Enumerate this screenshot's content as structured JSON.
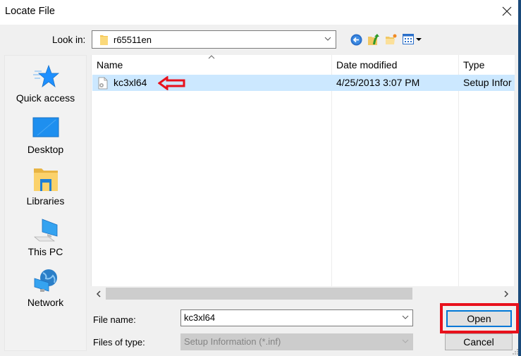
{
  "window": {
    "title": "Locate File",
    "close_icon": "close-icon"
  },
  "lookin": {
    "label": "Look in:",
    "value": "r65511en",
    "icon": "folder-icon"
  },
  "toolbar": {
    "buttons": [
      {
        "name": "back",
        "icon": "back-arrow-icon"
      },
      {
        "name": "up-one-level",
        "icon": "folder-up-icon"
      },
      {
        "name": "new-folder",
        "icon": "new-folder-icon"
      },
      {
        "name": "view-menu",
        "icon": "view-menu-icon"
      }
    ]
  },
  "places": [
    {
      "label": "Quick access",
      "icon": "star-icon"
    },
    {
      "label": "Desktop",
      "icon": "desktop-icon"
    },
    {
      "label": "Libraries",
      "icon": "libraries-icon"
    },
    {
      "label": "This PC",
      "icon": "computer-icon"
    },
    {
      "label": "Network",
      "icon": "network-icon"
    }
  ],
  "filelist": {
    "columns": [
      "Name",
      "Date modified",
      "Type"
    ],
    "sort_column": "Name",
    "sort_direction": "ascending",
    "rows": [
      {
        "name": "kc3xl64",
        "date_modified": "4/25/2013 3:07 PM",
        "type": "Setup Information",
        "type_visible": "Setup Infor",
        "selected": true
      }
    ]
  },
  "annotations": {
    "arrow_color": "#e8111c",
    "highlight_color": "#e8111c"
  },
  "form": {
    "filename_label": "File name:",
    "filename_value": "kc3xl64",
    "filetype_label": "Files of type:",
    "filetype_value": "Setup Information (*.inf)"
  },
  "buttons": {
    "open": "Open",
    "cancel": "Cancel"
  },
  "colors": {
    "selection": "#cce8ff",
    "default_button_border": "#0078d7"
  }
}
